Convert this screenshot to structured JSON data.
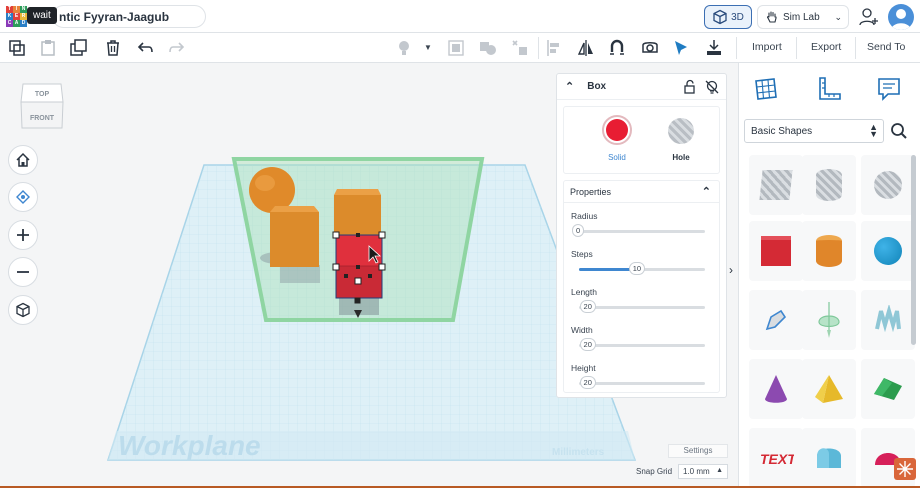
{
  "header": {
    "logo_letters": [
      "T",
      "I",
      "N",
      "K",
      "E",
      "R",
      "C",
      "A",
      "D"
    ],
    "tooltip": "wait",
    "design_title": "ntic Fyyran-Jaagub",
    "view_3d_label": "3D",
    "sim_lab_label": "Sim Lab"
  },
  "toolbar": {
    "import_label": "Import",
    "export_label": "Export",
    "send_to_label": "Send To"
  },
  "viewcube": {
    "top_label": "TOP",
    "front_label": "FRONT"
  },
  "canvas": {
    "workplane_label": "Workplane",
    "units_label": "Millimeters",
    "settings_label": "Settings",
    "snap_grid_label": "Snap Grid",
    "snap_grid_value": "1.0 mm"
  },
  "inspector": {
    "title": "Box",
    "solid_label": "Solid",
    "hole_label": "Hole",
    "solid_color": "#e81d33",
    "properties_label": "Properties",
    "properties": [
      {
        "label": "Radius",
        "value": "0",
        "fraction": 0.0
      },
      {
        "label": "Steps",
        "value": "10",
        "fraction": 0.45
      },
      {
        "label": "Length",
        "value": "20",
        "fraction": 0.06
      },
      {
        "label": "Width",
        "value": "20",
        "fraction": 0.06
      },
      {
        "label": "Height",
        "value": "20",
        "fraction": 0.06
      }
    ]
  },
  "shapes_panel": {
    "category": "Basic Shapes",
    "shapes": [
      "box-striped",
      "cylinder-striped",
      "sphere-striped",
      "box",
      "cylinder",
      "sphere",
      "scribble",
      "paraboloid",
      "text-3d-striped",
      "cone",
      "pyramid",
      "roof",
      "text",
      "half-cylinder",
      "half-sphere"
    ]
  },
  "colors": {
    "accent": "#3f87d0",
    "box_red": "#d42a35",
    "box_orange": "#e08a2a",
    "workplane_grid": "#a8d4e8"
  }
}
